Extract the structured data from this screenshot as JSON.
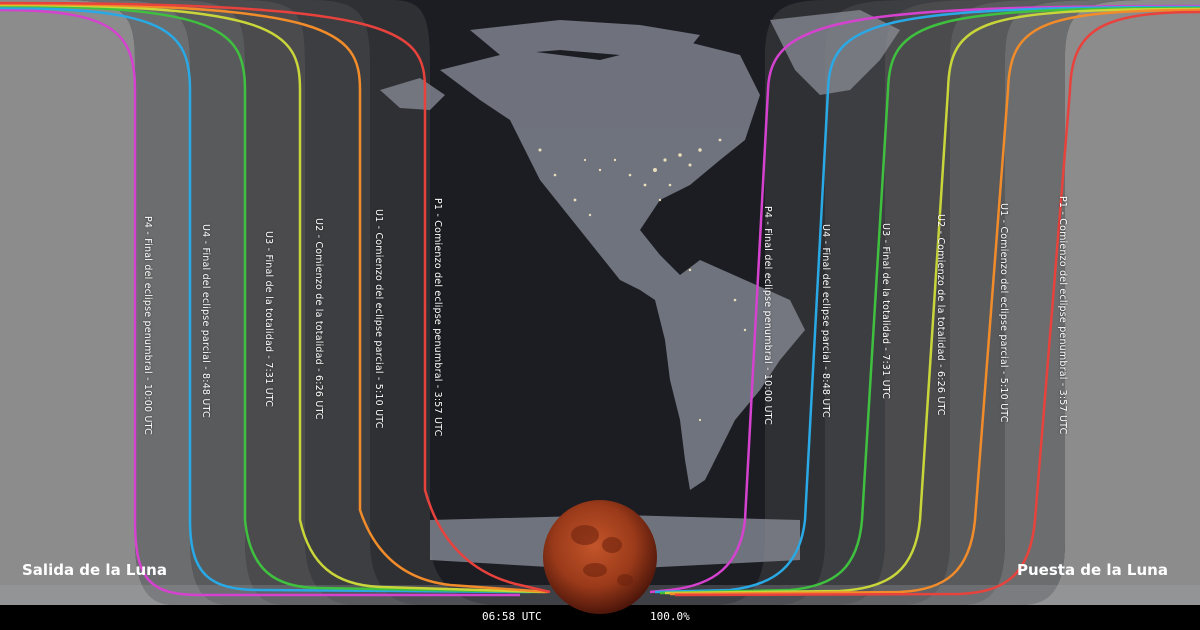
{
  "corners": {
    "moonrise": "Salida de la Luna",
    "moonset": "Puesta de la Luna"
  },
  "status_bar": {
    "time": "06:58 UTC",
    "percent": "100.0%"
  },
  "contacts_west": [
    {
      "id": "p4",
      "color": "#d642d0",
      "label": "P4 - Final del eclipse penumbral - 10:00 UTC"
    },
    {
      "id": "u4",
      "color": "#29a9e6",
      "label": "U4 - Final del eclipse parcial - 8:48 UTC"
    },
    {
      "id": "u3",
      "color": "#3fc13f",
      "label": "U3 - Final de la totalidad - 7:31 UTC"
    },
    {
      "id": "u2",
      "color": "#c9d63a",
      "label": "U2 - Comienzo de la totalidad - 6:26 UTC"
    },
    {
      "id": "u1",
      "color": "#f28c2a",
      "label": "U1 - Comienzo del eclipse parcial - 5:10 UTC"
    },
    {
      "id": "p1",
      "color": "#e8423d",
      "label": "P1 - Comienzo del eclipse penumbral - 3:57 UTC"
    }
  ],
  "contacts_east": [
    {
      "id": "p4",
      "color": "#d642d0",
      "label": "P4 - Final del eclipse penumbral - 10:00 UTC"
    },
    {
      "id": "u4",
      "color": "#29a9e6",
      "label": "U4 - Final del eclipse parcial - 8:48 UTC"
    },
    {
      "id": "u3",
      "color": "#3fc13f",
      "label": "U3 - Final de la totalidad - 7:31 UTC"
    },
    {
      "id": "u2",
      "color": "#c9d63a",
      "label": "U2 - Comienzo de la totalidad - 6:26 UTC"
    },
    {
      "id": "u1",
      "color": "#f28c2a",
      "label": "U1 - Comienzo del eclipse parcial - 5:10 UTC"
    },
    {
      "id": "p1",
      "color": "#e8423d",
      "label": "P1 - Comienzo del eclipse penumbral - 3:57 UTC"
    }
  ],
  "colors": {
    "no_visibility": "#8c8c8c",
    "night_land": "#b4b9c8",
    "night_ocean": "#1c1d22",
    "moon_red": "#b3441f",
    "moon_dark": "#5e1c0c",
    "status_bar": "#000000",
    "city_lights": "#fff2c8"
  }
}
